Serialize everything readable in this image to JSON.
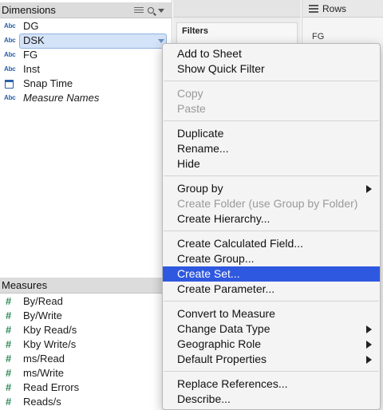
{
  "dimensions": {
    "title": "Dimensions",
    "items": [
      {
        "type": "Abc",
        "label": "DG"
      },
      {
        "type": "Abc",
        "label": "DSK"
      },
      {
        "type": "Abc",
        "label": "FG"
      },
      {
        "type": "Abc",
        "label": "Inst"
      },
      {
        "type": "",
        "label": "Snap Time",
        "icon": "calendar-clock-icon"
      },
      {
        "type": "Abc",
        "label": "Measure Names"
      }
    ],
    "selected_index": 1
  },
  "measures": {
    "title": "Measures",
    "items": [
      {
        "type": "#",
        "label": "By/Read"
      },
      {
        "type": "#",
        "label": "By/Write"
      },
      {
        "type": "#",
        "label": "Kby Read/s"
      },
      {
        "type": "#",
        "label": "Kby Write/s"
      },
      {
        "type": "#",
        "label": "ms/Read"
      },
      {
        "type": "#",
        "label": "ms/Write"
      },
      {
        "type": "#",
        "label": "Read Errors"
      },
      {
        "type": "#",
        "label": "Reads/s"
      }
    ]
  },
  "filters": {
    "title": "Filters"
  },
  "rows": {
    "label": "Rows"
  },
  "view": {
    "column_header": "FG"
  },
  "context_menu": {
    "add_to_sheet": "Add to Sheet",
    "show_quick_filter": "Show Quick Filter",
    "copy": "Copy",
    "paste": "Paste",
    "duplicate": "Duplicate",
    "rename": "Rename...",
    "hide": "Hide",
    "group_by": "Group by",
    "create_folder": "Create Folder (use Group by Folder)",
    "create_hierarchy": "Create Hierarchy...",
    "create_calculated_field": "Create Calculated Field...",
    "create_group": "Create Group...",
    "create_set": "Create Set...",
    "create_parameter": "Create Parameter...",
    "convert_to_measure": "Convert to Measure",
    "change_data_type": "Change Data Type",
    "geographic_role": "Geographic Role",
    "default_properties": "Default Properties",
    "replace_references": "Replace References...",
    "describe": "Describe..."
  },
  "colors": {
    "highlight": "#2f58e0",
    "selection": "#d4e3f7",
    "header": "#dcdcdc"
  }
}
